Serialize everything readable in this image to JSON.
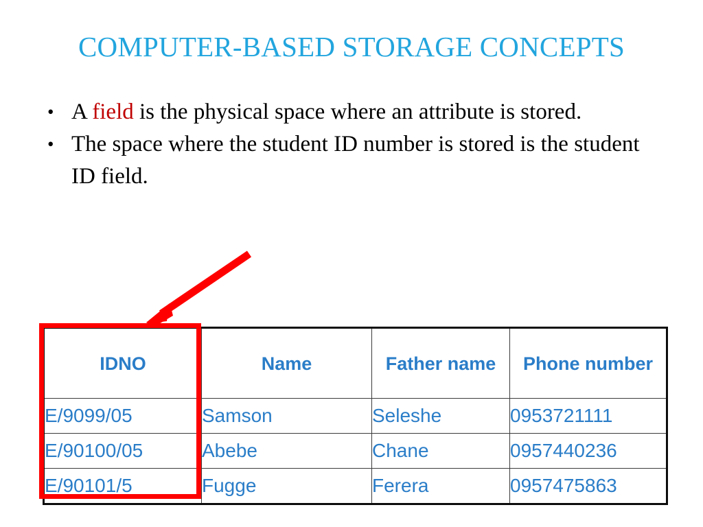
{
  "slide": {
    "title": "COMPUTER-BASED STORAGE CONCEPTS",
    "title_color": "#22A5DE",
    "background_color": "#FFFFFF"
  },
  "bullets": [
    {
      "marker": "•",
      "prefix": "A ",
      "keyword": "field",
      "keyword_color": "#C00000",
      "suffix": " is the physical space where an attribute is stored.",
      "full_text": "A field is the physical space where an attribute is stored."
    },
    {
      "marker": "•",
      "prefix": "",
      "keyword": "",
      "keyword_color": "#000000",
      "suffix": "The space where the student ID number is stored is the student ID field.",
      "full_text": "The space where the student ID number is stored is the student ID field."
    }
  ],
  "table": {
    "text_color": "#2A7DC8",
    "border_color": "#0D0D0D",
    "headers": [
      "IDNO",
      "Name",
      "Father name",
      "Phone number"
    ],
    "rows": [
      [
        "E/9099/05",
        "Samson",
        "Seleshe",
        "0953721111"
      ],
      [
        "E/90100/05",
        "Abebe",
        "Chane",
        "0957440236"
      ],
      [
        "E/90101/5",
        "Fugge",
        "Ferera",
        "0957475863"
      ]
    ]
  },
  "annotations": {
    "highlight_box": {
      "target_column": "IDNO",
      "color": "#FF0000"
    },
    "arrow": {
      "color": "#FF0000",
      "points_to": "IDNO column"
    }
  }
}
